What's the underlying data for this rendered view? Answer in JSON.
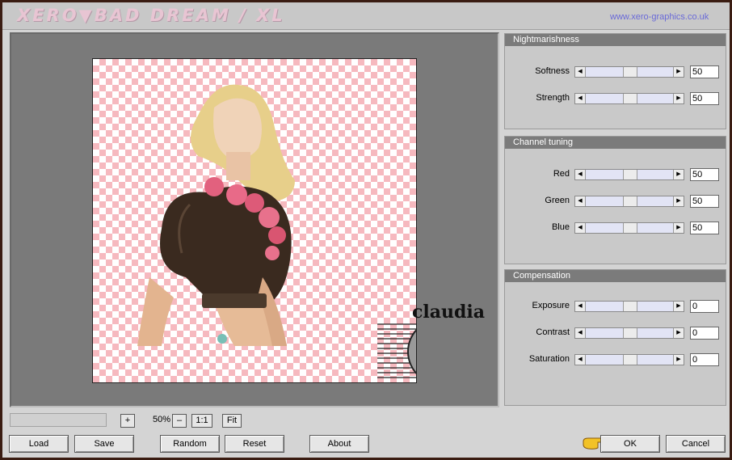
{
  "window": {
    "title": "XERO▼BAD DREAM / XL",
    "url": "www.xero-graphics.co.uk"
  },
  "panels": [
    {
      "title": "Nightmarishness",
      "rows": [
        {
          "label": "Softness",
          "value": "50"
        },
        {
          "label": "Strength",
          "value": "50"
        }
      ]
    },
    {
      "title": "Channel tuning",
      "rows": [
        {
          "label": "Red",
          "value": "50"
        },
        {
          "label": "Green",
          "value": "50"
        },
        {
          "label": "Blue",
          "value": "50"
        }
      ]
    },
    {
      "title": "Compensation",
      "rows": [
        {
          "label": "Exposure",
          "value": "0"
        },
        {
          "label": "Contrast",
          "value": "0"
        },
        {
          "label": "Saturation",
          "value": "0"
        }
      ]
    }
  ],
  "zoombar": {
    "plus": "+",
    "zoom": "50%",
    "minus": "–",
    "one_to_one": "1:1",
    "fit": "Fit"
  },
  "buttons": {
    "load": "Load",
    "save": "Save",
    "random": "Random",
    "reset": "Reset",
    "about": "About",
    "ok": "OK",
    "cancel": "Cancel"
  },
  "watermark": {
    "text": "claudia"
  },
  "colors": {
    "checker": "#f6b9bf",
    "panel_header": "#7b7b7b",
    "title": "#e8c5d3",
    "url": "#6a6ad8"
  }
}
